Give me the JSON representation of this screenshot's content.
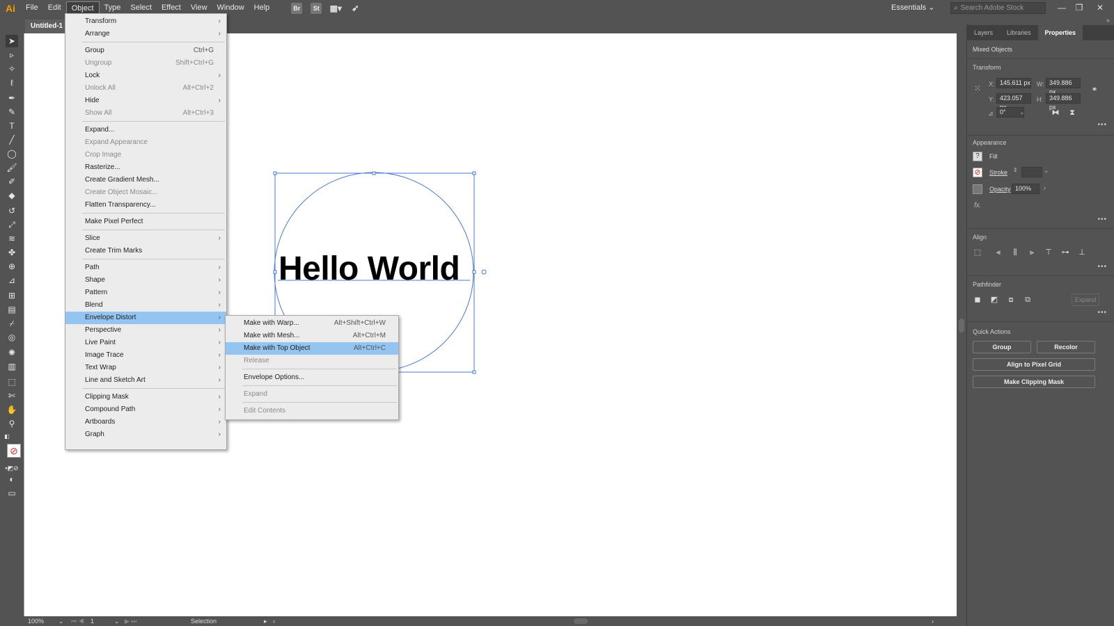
{
  "app": {
    "logo": "Ai"
  },
  "menubar": {
    "items": [
      "File",
      "Edit",
      "Object",
      "Type",
      "Select",
      "Effect",
      "View",
      "Window",
      "Help"
    ],
    "active": "Object",
    "icons": {
      "bridge": "Br",
      "stock": "St",
      "arrange": "arrange-documents-icon",
      "gpu": "rocket-icon"
    },
    "workspace": "Essentials",
    "search_placeholder": "Search Adobe Stock"
  },
  "document": {
    "tab_title": "Untitled-1 ["
  },
  "canvas": {
    "text": "Hello World"
  },
  "object_menu": {
    "items": [
      {
        "label": "Transform",
        "submenu": true
      },
      {
        "label": "Arrange",
        "submenu": true
      },
      {
        "separator": true
      },
      {
        "label": "Group",
        "shortcut": "Ctrl+G"
      },
      {
        "label": "Ungroup",
        "shortcut": "Shift+Ctrl+G",
        "disabled": true
      },
      {
        "label": "Lock",
        "submenu": true
      },
      {
        "label": "Unlock All",
        "shortcut": "Alt+Ctrl+2",
        "disabled": true
      },
      {
        "label": "Hide",
        "submenu": true
      },
      {
        "label": "Show All",
        "shortcut": "Alt+Ctrl+3",
        "disabled": true
      },
      {
        "separator": true
      },
      {
        "label": "Expand..."
      },
      {
        "label": "Expand Appearance",
        "disabled": true
      },
      {
        "label": "Crop Image",
        "disabled": true
      },
      {
        "label": "Rasterize..."
      },
      {
        "label": "Create Gradient Mesh..."
      },
      {
        "label": "Create Object Mosaic...",
        "disabled": true
      },
      {
        "label": "Flatten Transparency..."
      },
      {
        "separator": true
      },
      {
        "label": "Make Pixel Perfect"
      },
      {
        "separator": true
      },
      {
        "label": "Slice",
        "submenu": true
      },
      {
        "label": "Create Trim Marks"
      },
      {
        "separator": true
      },
      {
        "label": "Path",
        "submenu": true
      },
      {
        "label": "Shape",
        "submenu": true
      },
      {
        "label": "Pattern",
        "submenu": true
      },
      {
        "label": "Blend",
        "submenu": true
      },
      {
        "label": "Envelope Distort",
        "submenu": true,
        "highlight": true
      },
      {
        "label": "Perspective",
        "submenu": true
      },
      {
        "label": "Live Paint",
        "submenu": true
      },
      {
        "label": "Image Trace",
        "submenu": true
      },
      {
        "label": "Text Wrap",
        "submenu": true
      },
      {
        "label": "Line and Sketch Art",
        "submenu": true
      },
      {
        "separator": true
      },
      {
        "label": "Clipping Mask",
        "submenu": true
      },
      {
        "label": "Compound Path",
        "submenu": true
      },
      {
        "label": "Artboards",
        "submenu": true
      },
      {
        "label": "Graph",
        "submenu": true
      }
    ]
  },
  "envelope_menu": {
    "items": [
      {
        "label": "Make with Warp...",
        "shortcut": "Alt+Shift+Ctrl+W"
      },
      {
        "label": "Make with Mesh...",
        "shortcut": "Alt+Ctrl+M"
      },
      {
        "label": "Make with Top Object",
        "shortcut": "Alt+Ctrl+C",
        "highlight": true
      },
      {
        "label": "Release",
        "disabled": true
      },
      {
        "separator": true
      },
      {
        "label": "Envelope Options..."
      },
      {
        "separator": true
      },
      {
        "label": "Expand",
        "disabled": true
      },
      {
        "separator": true
      },
      {
        "label": "Edit Contents",
        "disabled": true
      }
    ]
  },
  "panel": {
    "tabs": [
      "Layers",
      "Libraries",
      "Properties"
    ],
    "active_tab": "Properties",
    "selection_type": "Mixed Objects",
    "transform": {
      "title": "Transform",
      "x_label": "X:",
      "x": "145.611 px",
      "y_label": "Y:",
      "y": "423.057 px",
      "w_label": "W:",
      "w": "349.886 px",
      "h_label": "H:",
      "h": "349.886 px",
      "angle": "0°"
    },
    "appearance": {
      "title": "Appearance",
      "fill_label": "Fill",
      "stroke_label": "Stroke",
      "opacity_label": "Opacity",
      "opacity": "100%",
      "fx": "fx."
    },
    "align": {
      "title": "Align"
    },
    "pathfinder": {
      "title": "Pathfinder",
      "expand": "Expand"
    },
    "quick_actions": {
      "title": "Quick Actions",
      "group": "Group",
      "recolor": "Recolor",
      "align_pixel": "Align to Pixel Grid",
      "clipping": "Make Clipping Mask"
    }
  },
  "status": {
    "zoom": "100%",
    "artboard": "1",
    "tool": "Selection"
  }
}
